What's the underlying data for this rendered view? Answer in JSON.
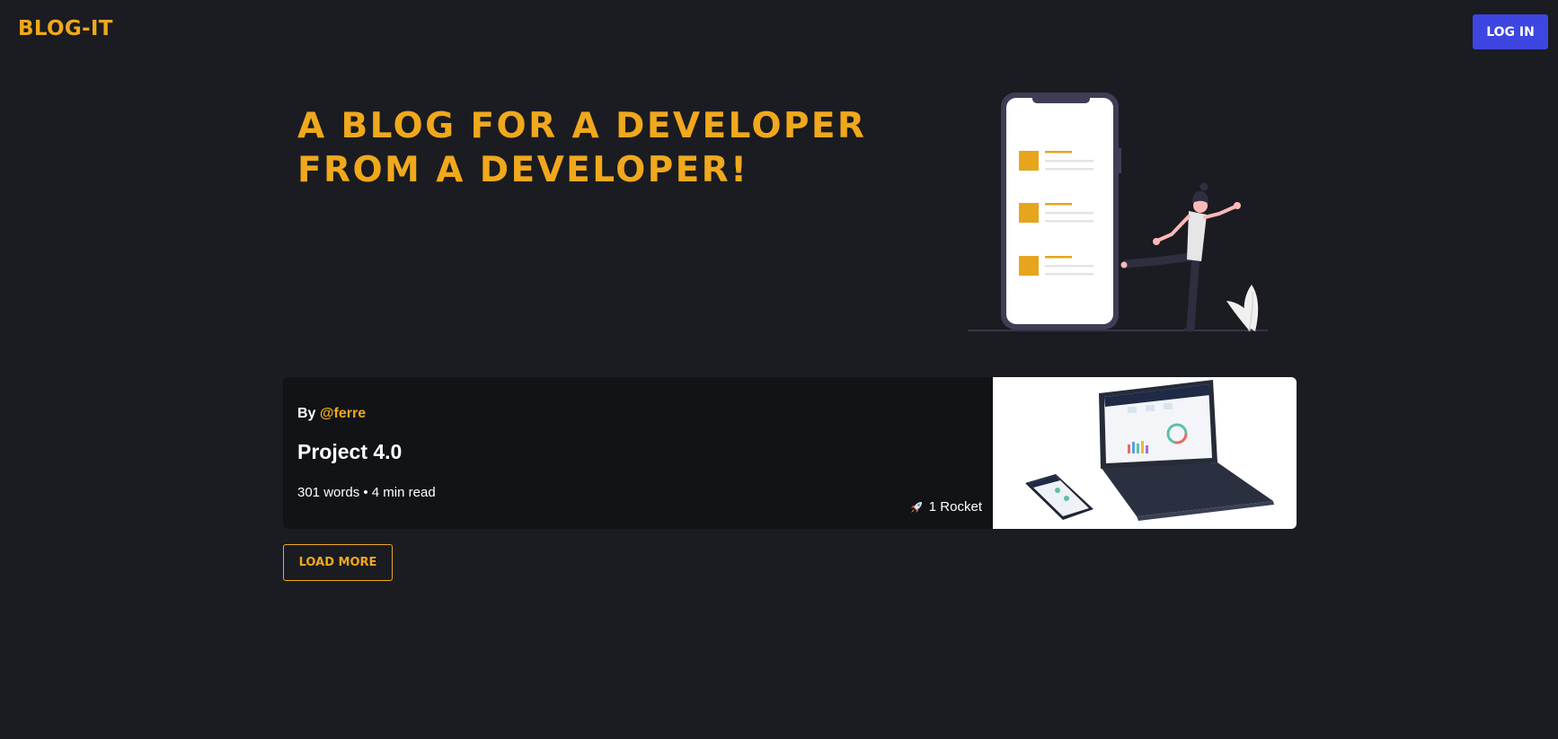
{
  "navbar": {
    "brand": "BLOG-IT",
    "login_label": "LOG IN"
  },
  "hero": {
    "title_line1": "A BLOG FOR A DEVELOPER",
    "title_line2": "FROM A DEVELOPER!",
    "illustration_icon": "woman-kicking-phone-illustration"
  },
  "posts": [
    {
      "author_prefix": "By",
      "author_handle": "@ferre",
      "title": "Project 4.0",
      "meta": "301 words • 4 min read",
      "reaction_icon": "rocket-icon",
      "reaction_text": "1 Rocket",
      "thumbnail_icon": "laptop-phone-dashboard-image"
    }
  ],
  "load_more_label": "LOAD MORE",
  "colors": {
    "background": "#1a1c21",
    "accent": "#f0a81c",
    "card": "#111317",
    "login_button": "#3d46e0"
  }
}
